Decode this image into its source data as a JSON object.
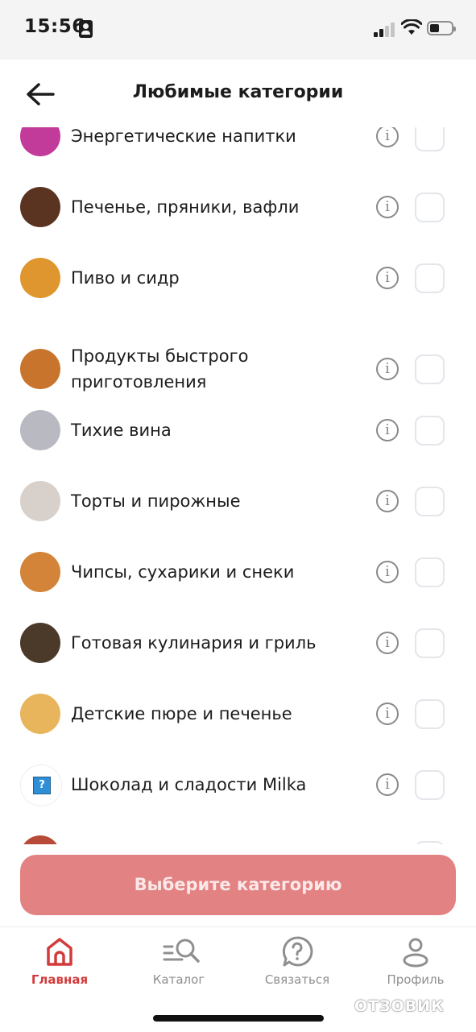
{
  "status_bar": {
    "time": "15:56",
    "battery_level": 0.4
  },
  "header": {
    "title": "Любимые категории"
  },
  "categories": [
    {
      "label": "Энергетические напитки",
      "checked": false,
      "thumb_color": "#c23a9a"
    },
    {
      "label": "Печенье, пряники, вафли",
      "checked": false,
      "thumb_color": "#5a3420"
    },
    {
      "label": "Пиво и сидр",
      "checked": false,
      "thumb_color": "#e0962e"
    },
    {
      "label": "Продукты быстрого приготовления",
      "checked": false,
      "thumb_color": "#c9742c"
    },
    {
      "label": "Тихие вина",
      "checked": false,
      "thumb_color": "#b9b9c2"
    },
    {
      "label": "Торты и пирожные",
      "checked": false,
      "thumb_color": "#d8d0cb"
    },
    {
      "label": "Чипсы, сухарики и снеки",
      "checked": false,
      "thumb_color": "#d48438"
    },
    {
      "label": "Готовая кулинария и гриль",
      "checked": false,
      "thumb_color": "#4b3a2a"
    },
    {
      "label": "Детские пюре и печенье",
      "checked": false,
      "thumb_color": "#e9b55c"
    },
    {
      "label": "Шоколад и сладости Milka",
      "checked": false,
      "thumb_color": "#ffffff"
    }
  ],
  "cta": {
    "label": "Выберите категорию"
  },
  "tabbar": {
    "items": [
      {
        "label": "Главная",
        "icon": "home-icon",
        "active": true
      },
      {
        "label": "Каталог",
        "icon": "catalog-search-icon",
        "active": false
      },
      {
        "label": "Связаться",
        "icon": "help-chat-icon",
        "active": false
      },
      {
        "label": "Профиль",
        "icon": "profile-icon",
        "active": false
      }
    ]
  },
  "watermark": {
    "text": "ОТЗОВИК"
  },
  "colors": {
    "accent": "#d23b3b",
    "cta_bg": "#e38282",
    "info": "#8a8a8a",
    "checkbox_border": "#e3e6ea"
  }
}
